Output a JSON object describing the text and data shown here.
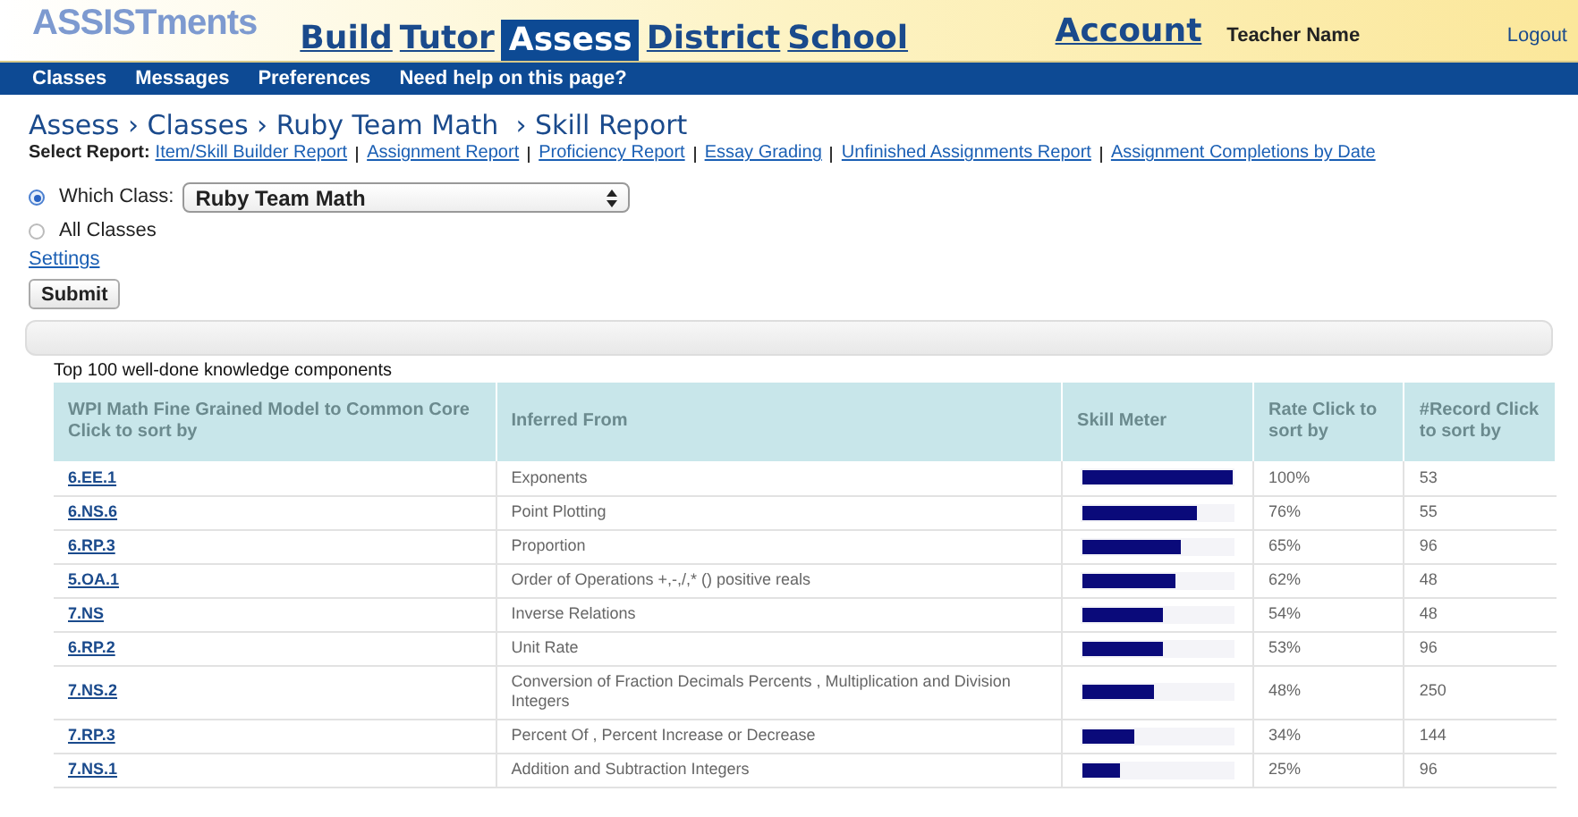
{
  "logo": "ASSISTments",
  "main_tabs": [
    {
      "label": "Build",
      "selected": false
    },
    {
      "label": "Tutor",
      "selected": false
    },
    {
      "label": "Assess",
      "selected": true
    },
    {
      "label": "District",
      "selected": false
    },
    {
      "label": "School",
      "selected": false
    }
  ],
  "account": "Account",
  "user_name": "Teacher Name",
  "logout": "Logout",
  "sub_nav": [
    "Classes",
    "Messages",
    "Preferences",
    "Need help on this page?"
  ],
  "breadcrumb": "Assess › Classes › Ruby Team Math  › Skill Report",
  "select_report": {
    "label": "Select Report:",
    "links": [
      "Item/Skill Builder Report",
      "Assignment Report",
      "Proficiency Report",
      "Essay Grading",
      "Unfinished Assignments Report",
      "Assignment Completions by Date"
    ]
  },
  "class_options": [
    {
      "label": "Which Class:",
      "selected": true,
      "value": "Ruby Team Math"
    },
    {
      "label": "All Classes",
      "selected": false
    }
  ],
  "settings_link": "Settings",
  "submit": "Submit",
  "table": {
    "caption": "Top 100 well-done knowledge components",
    "columns": [
      "WPI Math Fine Grained Model to Common Core Click to sort by",
      "Inferred From",
      "Skill Meter",
      "Rate Click to sort by",
      "#Record Click to sort by"
    ],
    "rows": [
      {
        "code": "6.EE.1",
        "inferred": "Exponents",
        "level": 1.0,
        "rate": "100%",
        "records": "53"
      },
      {
        "code": "6.NS.6",
        "inferred": "Point Plotting",
        "level": 0.76,
        "rate": "76%",
        "records": "55"
      },
      {
        "code": "6.RP.3",
        "inferred": "Proportion",
        "level": 0.65,
        "rate": "65%",
        "records": "96"
      },
      {
        "code": "5.OA.1",
        "inferred": "Order of Operations +,-,/,* () positive reals",
        "level": 0.62,
        "rate": "62%",
        "records": "48"
      },
      {
        "code": "7.NS",
        "inferred": "Inverse Relations",
        "level": 0.54,
        "rate": "54%",
        "records": "48"
      },
      {
        "code": "6.RP.2",
        "inferred": "Unit Rate",
        "level": 0.53,
        "rate": "53%",
        "records": "96"
      },
      {
        "code": "7.NS.2",
        "inferred": "Conversion of Fraction Decimals Percents , Multiplication and Division Integers",
        "level": 0.48,
        "rate": "48%",
        "records": "250"
      },
      {
        "code": "7.RP.3",
        "inferred": "Percent Of , Percent Increase or Decrease",
        "level": 0.34,
        "rate": "34%",
        "records": "144"
      },
      {
        "code": "7.NS.1",
        "inferred": "Addition and Subtraction Integers",
        "level": 0.25,
        "rate": "25%",
        "records": "96"
      }
    ]
  }
}
